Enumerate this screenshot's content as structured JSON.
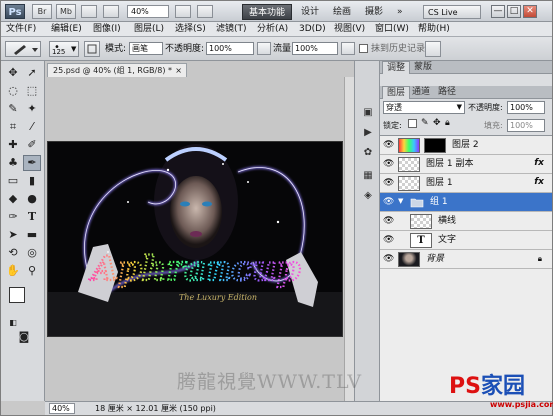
{
  "titlebar": {
    "app_logo": "Ps",
    "btn_br": "Br",
    "btn_mb": "Mb",
    "zoom": "40%",
    "workspaces": [
      "基本功能",
      "设计",
      "绘画",
      "摄影"
    ],
    "more": "»",
    "cslive": "CS Live",
    "window_buttons": [
      "—",
      "□",
      "✕"
    ]
  },
  "menubar": {
    "items": [
      "文件(F)",
      "编辑(E)",
      "图像(I)",
      "图层(L)",
      "选择(S)",
      "滤镜(T)",
      "分析(A)",
      "3D(D)",
      "视图(V)",
      "窗口(W)",
      "帮助(H)"
    ]
  },
  "options": {
    "brush_size": "125",
    "mode_label": "模式:",
    "mode_value": "画笔",
    "opacity_label": "不透明度:",
    "opacity_value": "100%",
    "flow_label": "流量:",
    "flow_value": "100%",
    "erase_history_label": "抹到历史记录"
  },
  "document": {
    "tab_title": "25.psd @ 40% (组 1, RGB/8) *",
    "tab_close": "×",
    "zoom": "40%",
    "doc_info": "18 厘米 × 12.01 厘米 (150 ppi)",
    "artwork_title": "Aphrancup",
    "artwork_subtitle": "The Luxury Edition"
  },
  "panels": {
    "top_tabs": [
      "调整",
      "蒙版"
    ],
    "layer_tabs": [
      "图层",
      "通道",
      "路径"
    ],
    "blend_mode": "穿透",
    "opacity_label": "不透明度:",
    "opacity_value": "100%",
    "lock_label": "锁定:",
    "fill_label": "填充:",
    "fill_value": "100%",
    "layers": [
      {
        "name": "图层 2"
      },
      {
        "name": "图层 1 副本",
        "fx": "fx"
      },
      {
        "name": "图层 1",
        "fx": "fx"
      },
      {
        "name": "组 1"
      },
      {
        "name": "横线"
      },
      {
        "name": "文字",
        "thumb_label": "T"
      },
      {
        "name": "背景"
      }
    ]
  },
  "watermarks": {
    "left": "腾龍視覺WWW.TLV",
    "right_ps": "PS",
    "right_cn": "家园",
    "right_url": "www.psjia.com"
  },
  "colors": {
    "selected_layer": "#3b74c9",
    "canvas_bg": "#060608",
    "neon_blue": "#7f6bff",
    "neon_purple": "#c24bff"
  }
}
